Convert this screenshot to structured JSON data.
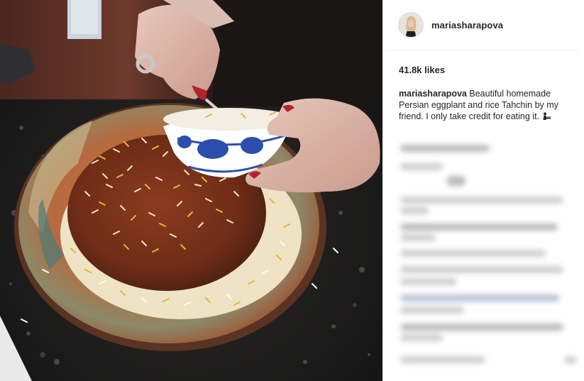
{
  "post": {
    "username": "mariasharapova",
    "likes": "41.8k likes",
    "caption": {
      "username": "mariasharapova",
      "text": "Beautiful homemade Persian eggplant and rice Tahchin by my friend. I only take credit for eating it."
    }
  },
  "icons": {
    "avatar": "profile-photo",
    "caption_emoji": "person-eating-emoji"
  },
  "colors": {
    "text": "#262626",
    "divider": "#efefef",
    "background": "#ffffff"
  }
}
